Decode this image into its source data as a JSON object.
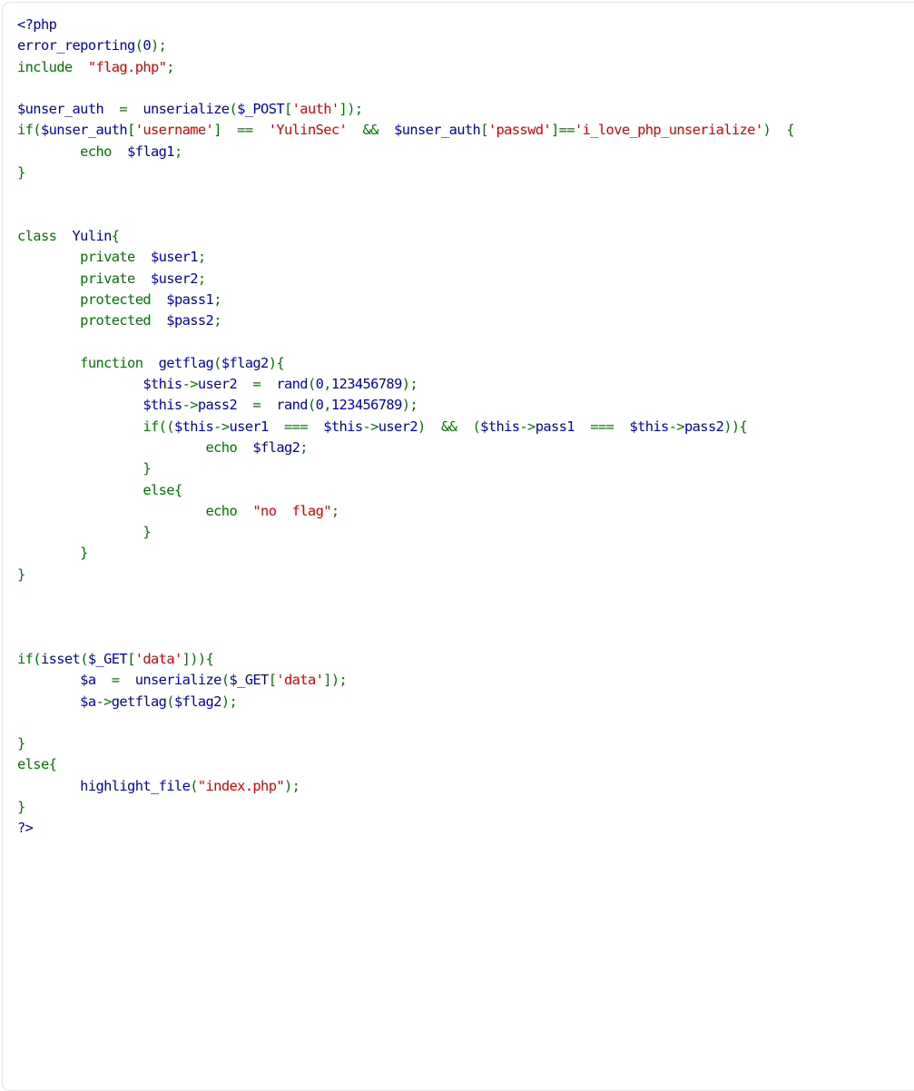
{
  "page": {
    "kind": "php-source-highlight",
    "language": "PHP",
    "file_title": "index.php"
  },
  "colors": {
    "background": "#ffffff",
    "box_border": "#e3e3e3",
    "default": "#0000BB",
    "keyword": "#007700",
    "string": "#DD0000",
    "comment": "#FF8000"
  },
  "code": {
    "lines": [
      {
        "indent": 0,
        "tokens": [
          {
            "t": "<?php",
            "c": "default"
          }
        ]
      },
      {
        "indent": 0,
        "tokens": [
          {
            "t": "error_reporting",
            "c": "default"
          },
          {
            "t": "(",
            "c": "keyword"
          },
          {
            "t": "0",
            "c": "default"
          },
          {
            "t": ");",
            "c": "keyword"
          }
        ]
      },
      {
        "indent": 0,
        "tokens": [
          {
            "t": "include",
            "c": "keyword"
          },
          {
            "t": "  ",
            "c": "keyword"
          },
          {
            "t": "\"flag.php\"",
            "c": "string"
          },
          {
            "t": ";",
            "c": "keyword"
          }
        ]
      },
      {
        "indent": 0,
        "tokens": []
      },
      {
        "indent": 0,
        "tokens": [
          {
            "t": "$unser_auth",
            "c": "default"
          },
          {
            "t": "  =  ",
            "c": "keyword"
          },
          {
            "t": "unserialize",
            "c": "default"
          },
          {
            "t": "(",
            "c": "keyword"
          },
          {
            "t": "$_POST",
            "c": "default"
          },
          {
            "t": "[",
            "c": "keyword"
          },
          {
            "t": "'auth'",
            "c": "string"
          },
          {
            "t": "]);",
            "c": "keyword"
          }
        ]
      },
      {
        "indent": 0,
        "tokens": [
          {
            "t": "if",
            "c": "keyword"
          },
          {
            "t": "(",
            "c": "keyword"
          },
          {
            "t": "$unser_auth",
            "c": "default"
          },
          {
            "t": "[",
            "c": "keyword"
          },
          {
            "t": "'username'",
            "c": "string"
          },
          {
            "t": "]  ==  ",
            "c": "keyword"
          },
          {
            "t": "'YulinSec'",
            "c": "string"
          },
          {
            "t": "  &&  ",
            "c": "keyword"
          },
          {
            "t": "$unser_auth",
            "c": "default"
          },
          {
            "t": "[",
            "c": "keyword"
          },
          {
            "t": "'passwd'",
            "c": "string"
          },
          {
            "t": "]==",
            "c": "keyword"
          },
          {
            "t": "'i_love_php_unserialize'",
            "c": "string"
          },
          {
            "t": ")  {",
            "c": "keyword"
          }
        ]
      },
      {
        "indent": 8,
        "tokens": [
          {
            "t": "echo",
            "c": "keyword"
          },
          {
            "t": "  ",
            "c": "keyword"
          },
          {
            "t": "$flag1",
            "c": "default"
          },
          {
            "t": ";",
            "c": "keyword"
          }
        ]
      },
      {
        "indent": 0,
        "tokens": [
          {
            "t": "}",
            "c": "keyword"
          }
        ]
      },
      {
        "indent": 0,
        "tokens": []
      },
      {
        "indent": 0,
        "tokens": []
      },
      {
        "indent": 0,
        "tokens": [
          {
            "t": "class",
            "c": "keyword"
          },
          {
            "t": "  ",
            "c": "keyword"
          },
          {
            "t": "Yulin",
            "c": "default"
          },
          {
            "t": "{",
            "c": "keyword"
          }
        ]
      },
      {
        "indent": 8,
        "tokens": [
          {
            "t": "private",
            "c": "keyword"
          },
          {
            "t": "  ",
            "c": "keyword"
          },
          {
            "t": "$user1",
            "c": "default"
          },
          {
            "t": ";",
            "c": "keyword"
          }
        ]
      },
      {
        "indent": 8,
        "tokens": [
          {
            "t": "private",
            "c": "keyword"
          },
          {
            "t": "  ",
            "c": "keyword"
          },
          {
            "t": "$user2",
            "c": "default"
          },
          {
            "t": ";",
            "c": "keyword"
          }
        ]
      },
      {
        "indent": 8,
        "tokens": [
          {
            "t": "protected",
            "c": "keyword"
          },
          {
            "t": "  ",
            "c": "keyword"
          },
          {
            "t": "$pass1",
            "c": "default"
          },
          {
            "t": ";",
            "c": "keyword"
          }
        ]
      },
      {
        "indent": 8,
        "tokens": [
          {
            "t": "protected",
            "c": "keyword"
          },
          {
            "t": "  ",
            "c": "keyword"
          },
          {
            "t": "$pass2",
            "c": "default"
          },
          {
            "t": ";",
            "c": "keyword"
          }
        ]
      },
      {
        "indent": 0,
        "tokens": []
      },
      {
        "indent": 8,
        "tokens": [
          {
            "t": "function",
            "c": "keyword"
          },
          {
            "t": "  ",
            "c": "keyword"
          },
          {
            "t": "getflag",
            "c": "default"
          },
          {
            "t": "(",
            "c": "keyword"
          },
          {
            "t": "$flag2",
            "c": "default"
          },
          {
            "t": "){",
            "c": "keyword"
          }
        ]
      },
      {
        "indent": 16,
        "tokens": [
          {
            "t": "$this",
            "c": "default"
          },
          {
            "t": "->",
            "c": "keyword"
          },
          {
            "t": "user2",
            "c": "default"
          },
          {
            "t": "  =  ",
            "c": "keyword"
          },
          {
            "t": "rand",
            "c": "default"
          },
          {
            "t": "(",
            "c": "keyword"
          },
          {
            "t": "0",
            "c": "default"
          },
          {
            "t": ",",
            "c": "keyword"
          },
          {
            "t": "123456789",
            "c": "default"
          },
          {
            "t": ");",
            "c": "keyword"
          }
        ]
      },
      {
        "indent": 16,
        "tokens": [
          {
            "t": "$this",
            "c": "default"
          },
          {
            "t": "->",
            "c": "keyword"
          },
          {
            "t": "pass2",
            "c": "default"
          },
          {
            "t": "  =  ",
            "c": "keyword"
          },
          {
            "t": "rand",
            "c": "default"
          },
          {
            "t": "(",
            "c": "keyword"
          },
          {
            "t": "0",
            "c": "default"
          },
          {
            "t": ",",
            "c": "keyword"
          },
          {
            "t": "123456789",
            "c": "default"
          },
          {
            "t": ");",
            "c": "keyword"
          }
        ]
      },
      {
        "indent": 16,
        "tokens": [
          {
            "t": "if",
            "c": "keyword"
          },
          {
            "t": "((",
            "c": "keyword"
          },
          {
            "t": "$this",
            "c": "default"
          },
          {
            "t": "->",
            "c": "keyword"
          },
          {
            "t": "user1",
            "c": "default"
          },
          {
            "t": "  ===  ",
            "c": "keyword"
          },
          {
            "t": "$this",
            "c": "default"
          },
          {
            "t": "->",
            "c": "keyword"
          },
          {
            "t": "user2",
            "c": "default"
          },
          {
            "t": ")  &&  (",
            "c": "keyword"
          },
          {
            "t": "$this",
            "c": "default"
          },
          {
            "t": "->",
            "c": "keyword"
          },
          {
            "t": "pass1",
            "c": "default"
          },
          {
            "t": "  ===  ",
            "c": "keyword"
          },
          {
            "t": "$this",
            "c": "default"
          },
          {
            "t": "->",
            "c": "keyword"
          },
          {
            "t": "pass2",
            "c": "default"
          },
          {
            "t": ")){",
            "c": "keyword"
          }
        ]
      },
      {
        "indent": 24,
        "tokens": [
          {
            "t": "echo",
            "c": "keyword"
          },
          {
            "t": "  ",
            "c": "keyword"
          },
          {
            "t": "$flag2",
            "c": "default"
          },
          {
            "t": ";",
            "c": "keyword"
          }
        ]
      },
      {
        "indent": 16,
        "tokens": [
          {
            "t": "}",
            "c": "keyword"
          }
        ]
      },
      {
        "indent": 16,
        "tokens": [
          {
            "t": "else",
            "c": "keyword"
          },
          {
            "t": "{",
            "c": "keyword"
          }
        ]
      },
      {
        "indent": 24,
        "tokens": [
          {
            "t": "echo",
            "c": "keyword"
          },
          {
            "t": "  ",
            "c": "keyword"
          },
          {
            "t": "\"no  flag\"",
            "c": "string"
          },
          {
            "t": ";",
            "c": "keyword"
          }
        ]
      },
      {
        "indent": 16,
        "tokens": [
          {
            "t": "}",
            "c": "keyword"
          }
        ]
      },
      {
        "indent": 8,
        "tokens": [
          {
            "t": "}",
            "c": "keyword"
          }
        ]
      },
      {
        "indent": 0,
        "tokens": [
          {
            "t": "}",
            "c": "keyword"
          }
        ]
      },
      {
        "indent": 0,
        "tokens": []
      },
      {
        "indent": 0,
        "tokens": []
      },
      {
        "indent": 0,
        "tokens": []
      },
      {
        "indent": 0,
        "tokens": [
          {
            "t": "if",
            "c": "keyword"
          },
          {
            "t": "(",
            "c": "keyword"
          },
          {
            "t": "isset",
            "c": "default"
          },
          {
            "t": "(",
            "c": "keyword"
          },
          {
            "t": "$_GET",
            "c": "default"
          },
          {
            "t": "[",
            "c": "keyword"
          },
          {
            "t": "'data'",
            "c": "string"
          },
          {
            "t": "])){",
            "c": "keyword"
          }
        ]
      },
      {
        "indent": 8,
        "tokens": [
          {
            "t": "$a",
            "c": "default"
          },
          {
            "t": "  =  ",
            "c": "keyword"
          },
          {
            "t": "unserialize",
            "c": "default"
          },
          {
            "t": "(",
            "c": "keyword"
          },
          {
            "t": "$_GET",
            "c": "default"
          },
          {
            "t": "[",
            "c": "keyword"
          },
          {
            "t": "'data'",
            "c": "string"
          },
          {
            "t": "]);",
            "c": "keyword"
          }
        ]
      },
      {
        "indent": 8,
        "tokens": [
          {
            "t": "$a",
            "c": "default"
          },
          {
            "t": "->",
            "c": "keyword"
          },
          {
            "t": "getflag",
            "c": "default"
          },
          {
            "t": "(",
            "c": "keyword"
          },
          {
            "t": "$flag2",
            "c": "default"
          },
          {
            "t": ");",
            "c": "keyword"
          }
        ]
      },
      {
        "indent": 0,
        "tokens": []
      },
      {
        "indent": 0,
        "tokens": [
          {
            "t": "}",
            "c": "keyword"
          }
        ]
      },
      {
        "indent": 0,
        "tokens": [
          {
            "t": "else",
            "c": "keyword"
          },
          {
            "t": "{",
            "c": "keyword"
          }
        ]
      },
      {
        "indent": 8,
        "tokens": [
          {
            "t": "highlight_file",
            "c": "default"
          },
          {
            "t": "(",
            "c": "keyword"
          },
          {
            "t": "\"index.php\"",
            "c": "string"
          },
          {
            "t": ");",
            "c": "keyword"
          }
        ]
      },
      {
        "indent": 0,
        "tokens": [
          {
            "t": "}",
            "c": "keyword"
          }
        ]
      },
      {
        "indent": 0,
        "tokens": [
          {
            "t": "?>",
            "c": "default"
          }
        ]
      }
    ]
  }
}
